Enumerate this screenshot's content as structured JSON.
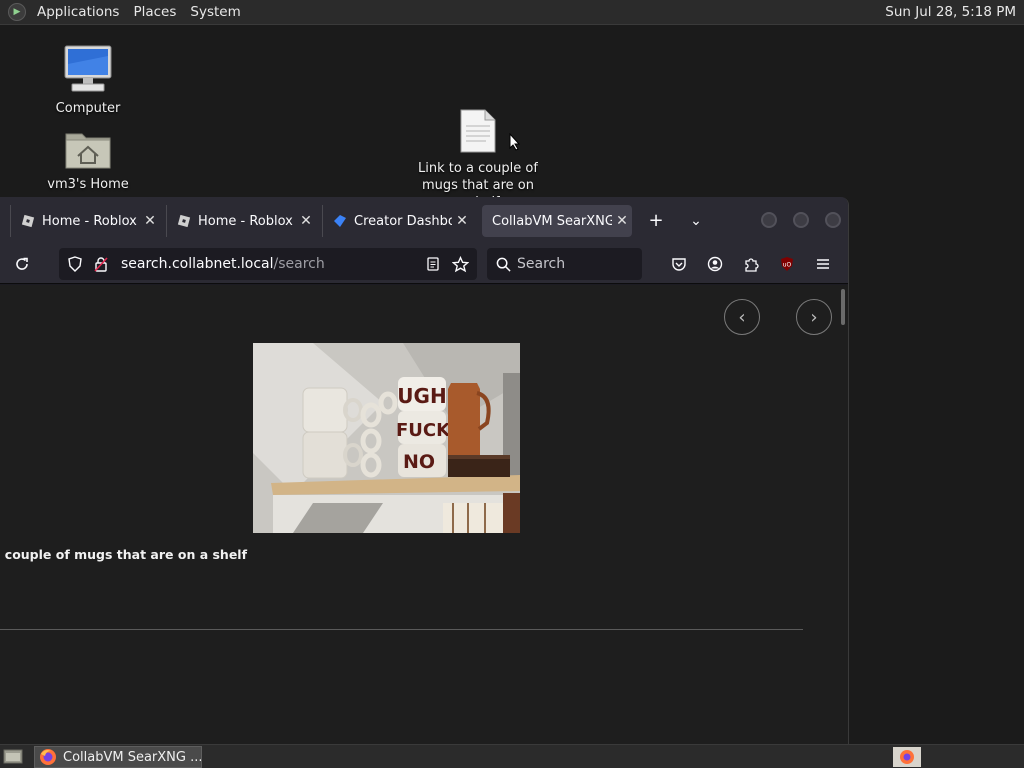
{
  "top_panel": {
    "menus": [
      "Applications",
      "Places",
      "System"
    ],
    "clock": "Sun Jul 28,  5:18 PM"
  },
  "desktop": {
    "icons": [
      {
        "label": "Computer"
      },
      {
        "label": "vm3's Home"
      },
      {
        "label": "Link to  a couple of mugs that are on a shelf"
      }
    ]
  },
  "browser": {
    "tabs": [
      {
        "title": "Home - Roblox"
      },
      {
        "title": "Home - Roblox"
      },
      {
        "title": "Creator Dashboard"
      },
      {
        "title": "CollabVM SearXNG"
      }
    ],
    "url": {
      "domain": "search.collabnet.local",
      "path": "/search"
    },
    "search_placeholder": "Search",
    "result": {
      "title": "a couple of mugs that are on a shelf",
      "image_text": [
        "UGH",
        "FUCK",
        "NO"
      ]
    }
  },
  "taskbar": {
    "task_label": "CollabVM SearXNG ..."
  }
}
